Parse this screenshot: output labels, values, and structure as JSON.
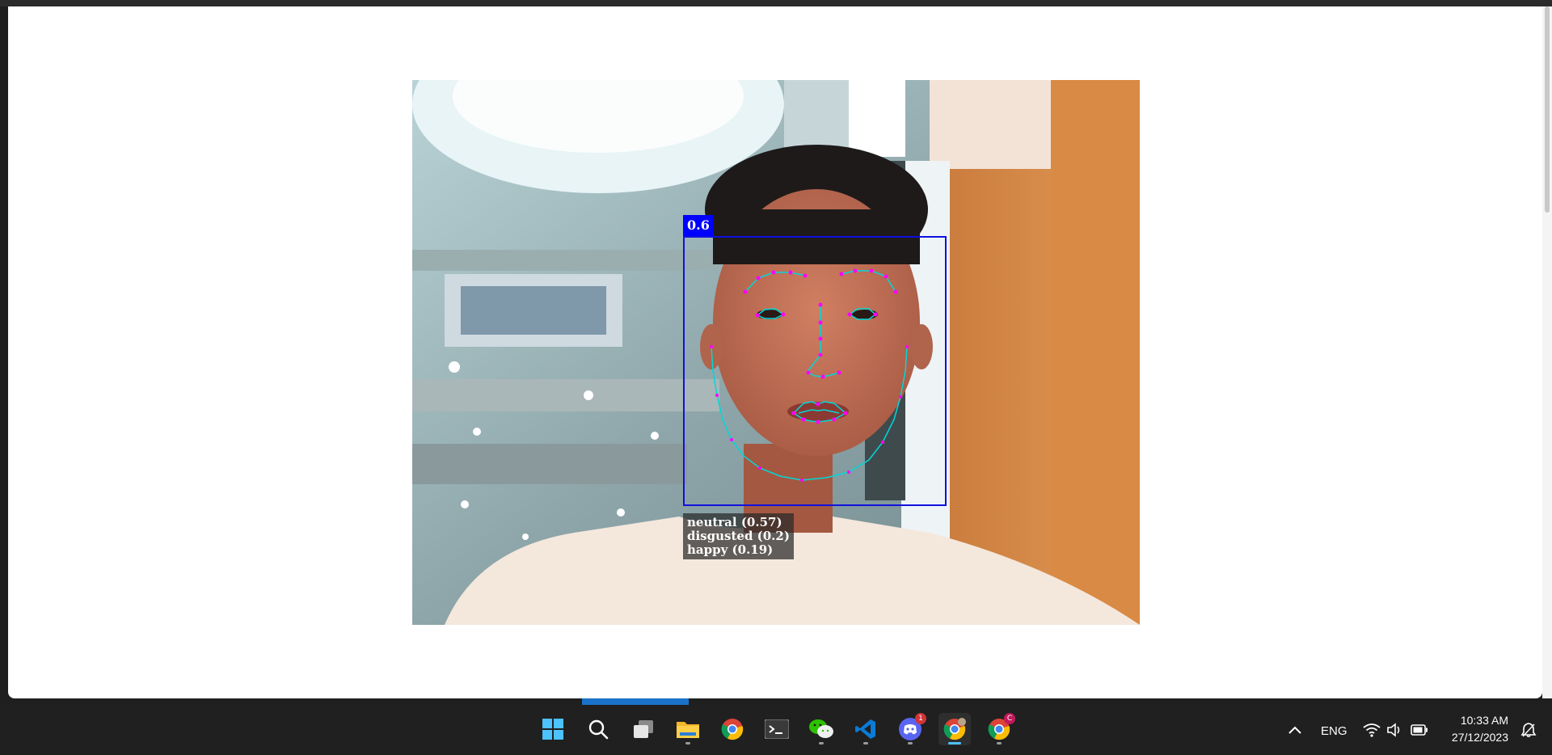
{
  "detection": {
    "score": "0.6",
    "expressions": [
      "neutral (0.57)",
      "disgusted (0.2)",
      "happy (0.19)"
    ]
  },
  "colors": {
    "box": "#0000ff",
    "landmark_line": "#00d8d8",
    "landmark_point": "#ff00ff",
    "taskbar": "#202020",
    "accent": "#4cc2ff"
  },
  "taskbar": {
    "apps": [
      {
        "name": "Start",
        "icon": "windows-start-icon"
      },
      {
        "name": "Search",
        "icon": "search-icon"
      },
      {
        "name": "Task View",
        "icon": "task-view-icon"
      },
      {
        "name": "File Explorer",
        "icon": "folder-icon"
      },
      {
        "name": "Google Chrome",
        "icon": "chrome-icon"
      },
      {
        "name": "Terminal",
        "icon": "terminal-icon"
      },
      {
        "name": "WeChat",
        "icon": "wechat-icon"
      },
      {
        "name": "Visual Studio Code",
        "icon": "vscode-icon"
      },
      {
        "name": "Discord",
        "icon": "discord-icon",
        "badge": "1"
      },
      {
        "name": "Google Chrome (profile)",
        "icon": "chrome-profile-icon"
      },
      {
        "name": "Google Chrome (profile C)",
        "icon": "chrome-profile-c-icon",
        "badge": "C"
      }
    ],
    "tray": {
      "language": "ENG",
      "time": "10:33 AM",
      "date": "27/12/2023"
    }
  }
}
